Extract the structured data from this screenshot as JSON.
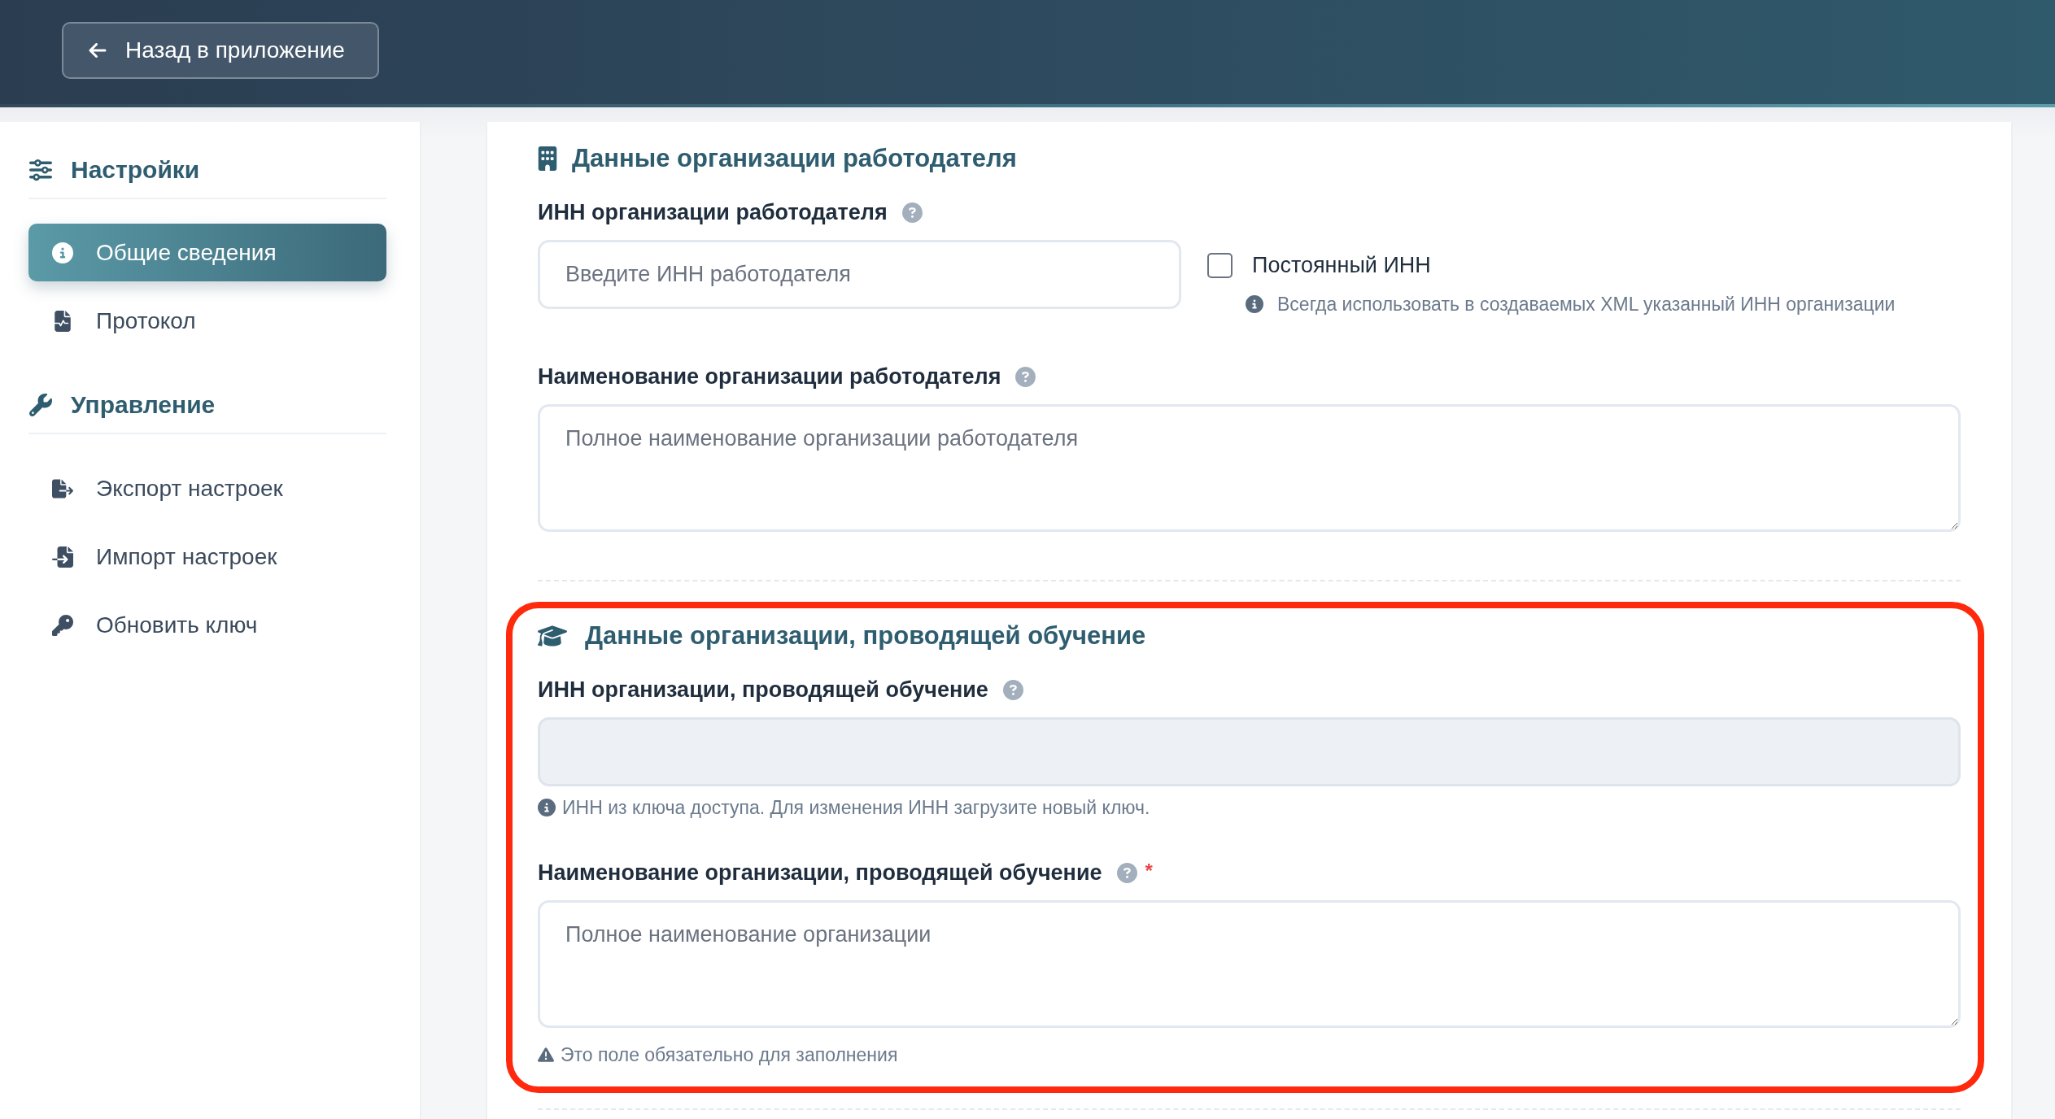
{
  "header": {
    "back_button": {
      "label": "Назад в приложение"
    }
  },
  "sidebar": {
    "groups": [
      {
        "title": "Настройки",
        "items": [
          {
            "label": "Общие сведения",
            "selected": true
          },
          {
            "label": "Протокол",
            "selected": false
          }
        ]
      },
      {
        "title": "Управление",
        "items": [
          {
            "label": "Экспорт настроек",
            "selected": false
          },
          {
            "label": "Импорт настроек",
            "selected": false
          },
          {
            "label": "Обновить ключ",
            "selected": false
          }
        ]
      }
    ]
  },
  "sections": [
    {
      "title": "Данные организации работодателя",
      "fields": [
        {
          "kind": "input",
          "label": "ИНН организации работодателя",
          "placeholder": "Введите ИНН работодателя",
          "disabled": false,
          "side_option": {
            "label": "Постоянный ИНН",
            "checked": false,
            "note": {
              "kind": "info",
              "text": "Всегда использовать в создаваемых XML указанный ИНН организации"
            }
          }
        },
        {
          "kind": "textarea",
          "label": "Наименование организации работодателя",
          "placeholder": "Полное наименование организации работодателя",
          "disabled": false
        }
      ]
    },
    {
      "title": "Данные организации, проводящей обучение",
      "highlighted": true,
      "fields": [
        {
          "kind": "input",
          "label": "ИНН организации, проводящей обучение",
          "disabled": true,
          "note": {
            "kind": "info",
            "text": "ИНН из ключа доступа. Для изменения ИНН загрузите новый ключ."
          }
        },
        {
          "kind": "textarea",
          "label": "Наименование организации, проводящей обучение",
          "required_mark": "*",
          "placeholder": "Полное наименование организации",
          "disabled": false,
          "note": {
            "kind": "warning",
            "text": "Это поле обязательно для заполнения"
          }
        }
      ]
    }
  ]
}
